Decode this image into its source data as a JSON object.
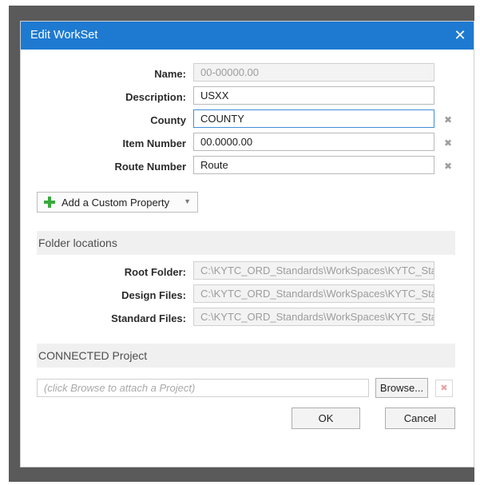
{
  "dialog": {
    "title": "Edit WorkSet",
    "close_glyph": "✕"
  },
  "fields": {
    "name": {
      "label": "Name:",
      "value": "00-00000.00"
    },
    "description": {
      "label": "Description:",
      "value": "USXX"
    },
    "county": {
      "label": "County",
      "value": "COUNTY"
    },
    "item_number": {
      "label": "Item Number",
      "value": "00.0000.00"
    },
    "route_number": {
      "label": "Route Number",
      "value": "Route"
    },
    "clear_glyph": "✖"
  },
  "custom_property": {
    "label": "Add a Custom Property",
    "arrow": "▼"
  },
  "folder_locations": {
    "header": "Folder locations",
    "root": {
      "label": "Root Folder:",
      "value": "C:\\KYTC_ORD_Standards\\WorkSpaces\\KYTC_Sta"
    },
    "design": {
      "label": "Design Files:",
      "value": "C:\\KYTC_ORD_Standards\\WorkSpaces\\KYTC_Sta"
    },
    "standard": {
      "label": "Standard Files:",
      "value": "C:\\KYTC_ORD_Standards\\WorkSpaces\\KYTC_Sta"
    }
  },
  "connected_project": {
    "header": "CONNECTED Project",
    "placeholder": "(click Browse to attach a Project)",
    "browse_label": "Browse...",
    "remove_glyph": "✖"
  },
  "footer": {
    "ok_label": "OK",
    "cancel_label": "Cancel"
  },
  "colors": {
    "titlebar": "#1e7ad1",
    "add_icon": "#37a93c",
    "focus_border": "#3e8ed8"
  }
}
